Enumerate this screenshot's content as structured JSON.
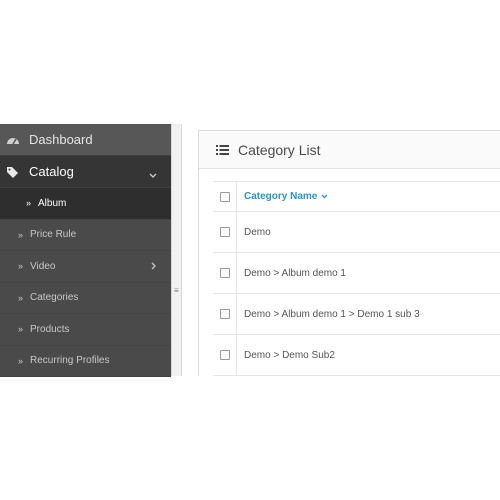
{
  "sidebar": {
    "dashboard_label": "Dashboard",
    "catalog_label": "Catalog",
    "items": [
      {
        "label": "Album",
        "active": true
      },
      {
        "label": "Price Rule"
      },
      {
        "label": "Video",
        "has_submenu": true
      },
      {
        "label": "Categories"
      },
      {
        "label": "Products"
      },
      {
        "label": "Recurring Profiles"
      }
    ]
  },
  "panel": {
    "title": "Category List",
    "column_header": "Category Name",
    "rows": [
      {
        "name": "Demo"
      },
      {
        "name": "Demo > Album demo 1"
      },
      {
        "name": "Demo > Album demo 1 > Demo 1 sub 3"
      },
      {
        "name": "Demo > Demo Sub2"
      }
    ]
  },
  "icons": [
    "dashboard-icon",
    "tags-icon",
    "chevron-down-icon",
    "double-angle-right-icon",
    "chevron-right-icon",
    "list-icon",
    "caret-down-icon",
    "grip-icon"
  ],
  "colors": {
    "sidebar": "#505050",
    "active": "#2e2e2e",
    "link": "#2a94c8"
  }
}
